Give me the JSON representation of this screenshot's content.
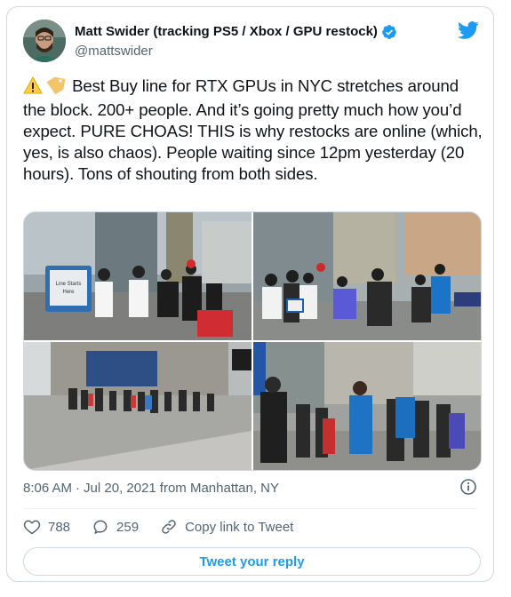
{
  "author": {
    "display_name": "Matt Swider (tracking PS5 / Xbox / GPU restock)",
    "handle": "@mattswider",
    "verified": true
  },
  "tweet": {
    "emoji_1": "⚠️",
    "emoji_2": "🏷️",
    "text": "Best Buy line for RTX GPUs in NYC stretches around the block. 200+ people. And it’s going pretty much how you’d expect. PURE CHOAS! THIS is why restocks are online (which, yes, is also chaos). People waiting since 12pm yesterday (20 hours). Tons of shouting from both sides.",
    "sign_text": "Line Starts Here"
  },
  "meta": {
    "time": "8:06 AM",
    "separator": "·",
    "date": "Jul 20, 2021",
    "source": "from Manhattan, NY"
  },
  "actions": {
    "likes": "788",
    "replies": "259",
    "copy_link": "Copy link to Tweet"
  },
  "reply_button": "Tweet your reply",
  "colors": {
    "accent": "#1d9bf0",
    "like_heart": "#536471",
    "text_primary": "#0f1419",
    "text_secondary": "#536471"
  },
  "icons": [
    "verified-badge-icon",
    "twitter-bird-icon",
    "warning-icon",
    "label-tag-icon",
    "info-icon",
    "heart-icon",
    "reply-bubble-icon",
    "link-icon"
  ]
}
